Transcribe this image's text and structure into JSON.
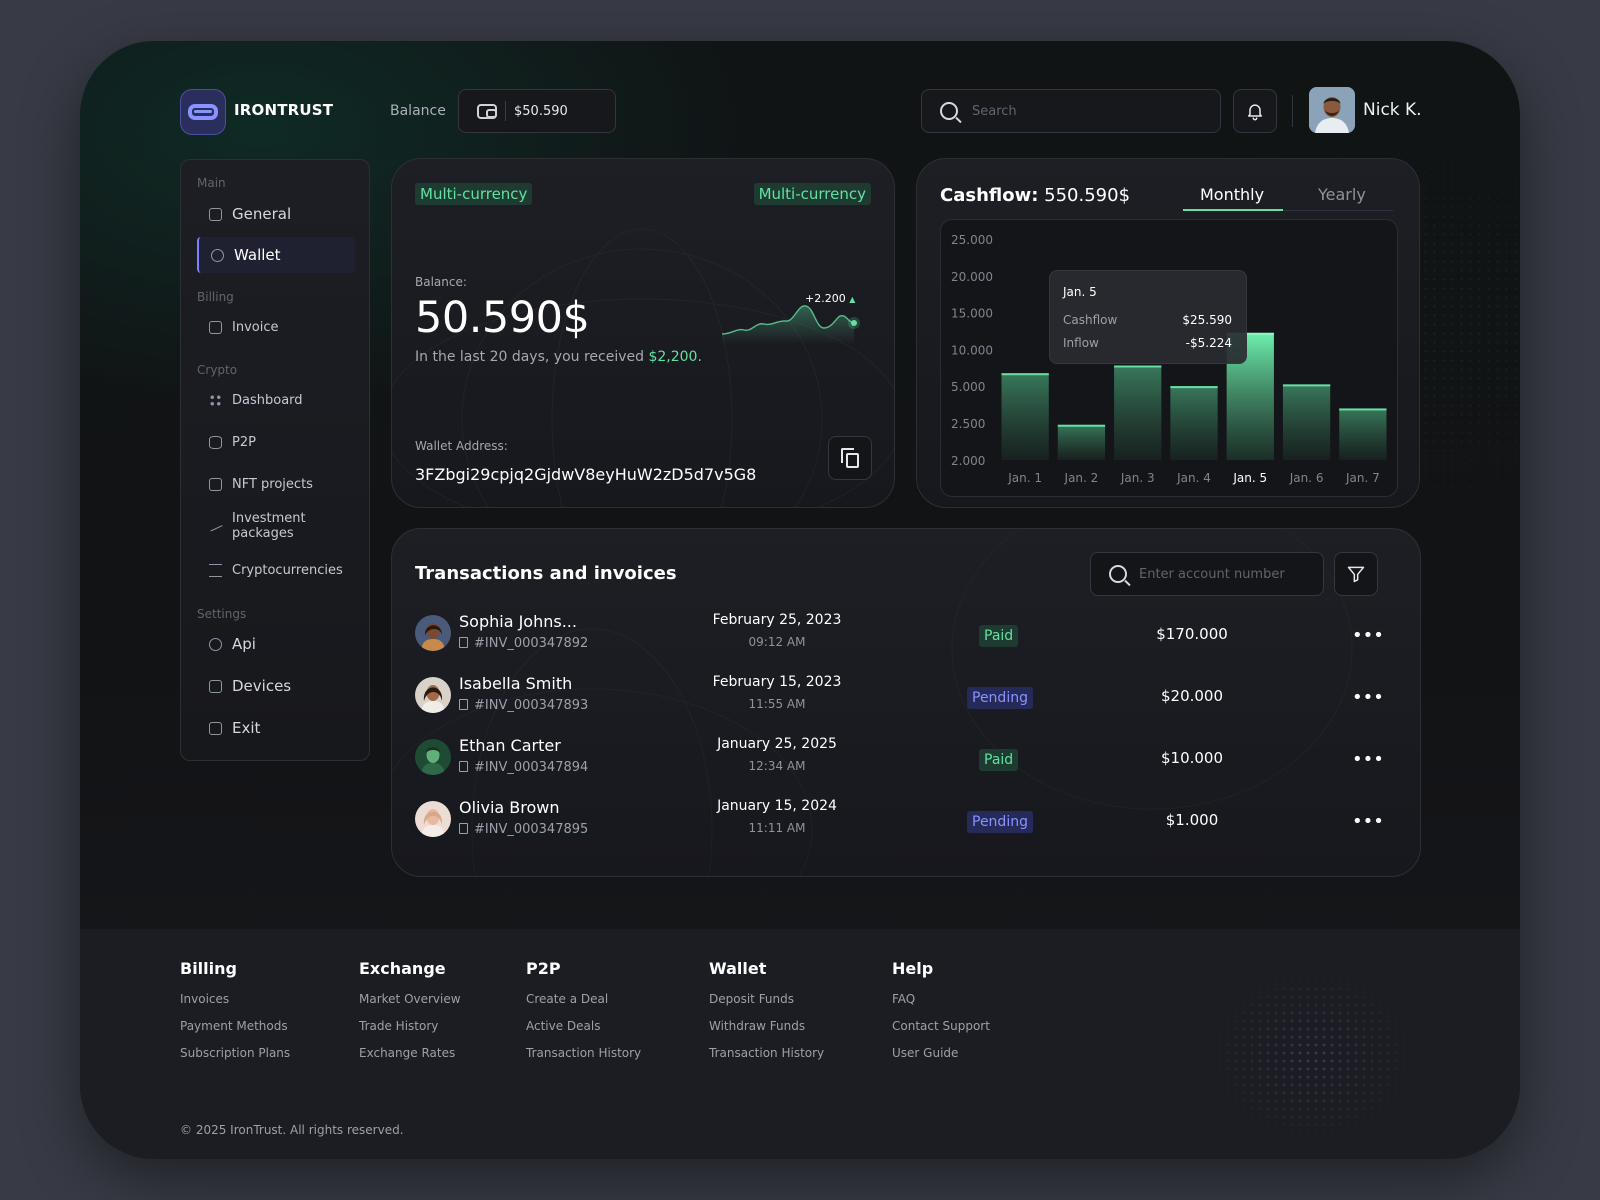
{
  "brand": {
    "name": "IRONTRUST"
  },
  "header": {
    "balance_label": "Balance",
    "balance_value": "$50.590",
    "search_placeholder": "Search",
    "user_name": "Nick K."
  },
  "sidebar": {
    "sections": {
      "main": "Main",
      "billing": "Billing",
      "crypto": "Crypto",
      "settings": "Settings"
    },
    "items": {
      "general": "General",
      "wallet": "Wallet",
      "invoice": "Invoice",
      "dashboard": "Dashboard",
      "p2p": "P2P",
      "nft": "NFT projects",
      "investment": "Investment packages",
      "cryptocurrencies": "Cryptocurrencies",
      "api": "Api",
      "devices": "Devices",
      "exit": "Exit"
    },
    "active": "Wallet"
  },
  "balance_card": {
    "tag_left": "Multi-currency",
    "tag_right": "Multi-currency",
    "label": "Balance:",
    "value": "50.590$",
    "note_prefix": "In the last 20 days, you received ",
    "note_amount": "$2,200.",
    "delta": "+2.200",
    "delta_arrow": "▲",
    "wallet_label": "Wallet Address:",
    "wallet_address": "3FZbgi29cpjq2GjdwV8eyHuW2zD5d7v5G8"
  },
  "cashflow": {
    "title_bold": "Cashflow:",
    "title_value": "550.590$",
    "tabs": [
      "Monthly",
      "Yearly"
    ],
    "active_tab": "Monthly",
    "tooltip": {
      "date": "Jan. 5",
      "rows": [
        {
          "label": "Cashflow",
          "value": "$25.590"
        },
        {
          "label": "Inflow",
          "value": "-$5.224"
        }
      ]
    }
  },
  "chart_data": {
    "type": "bar",
    "categories": [
      "Jan. 1",
      "Jan. 2",
      "Jan. 3",
      "Jan. 4",
      "Jan. 5",
      "Jan. 6",
      "Jan. 7"
    ],
    "values": [
      10100,
      4100,
      11000,
      8600,
      14800,
      8800,
      6000
    ],
    "highlighted": "Jan. 5",
    "y_ticks": [
      "25.000",
      "20.000",
      "15.000",
      "10.000",
      "5.000",
      "2.500",
      "2.000"
    ],
    "ylim": [
      0,
      27000
    ],
    "grid": false,
    "bar_color": "#63e0a2"
  },
  "transactions": {
    "title": "Transactions and invoices",
    "search_placeholder": "Enter account number",
    "rows": [
      {
        "name": "Sophia Johns...",
        "invoice": "#INV_000347892",
        "date": "February 25, 2023",
        "time": "09:12 AM",
        "status": "Paid",
        "amount": "$170.000"
      },
      {
        "name": "Isabella Smith",
        "invoice": "#INV_000347893",
        "date": "February 15, 2023",
        "time": "11:55 AM",
        "status": "Pending",
        "amount": "$20.000"
      },
      {
        "name": "Ethan Carter",
        "invoice": "#INV_000347894",
        "date": "January 25, 2025",
        "time": "12:34 AM",
        "status": "Paid",
        "amount": "$10.000"
      },
      {
        "name": "Olivia Brown",
        "invoice": "#INV_000347895",
        "date": "January 15, 2024",
        "time": "11:11 AM",
        "status": "Pending",
        "amount": "$1.000"
      }
    ],
    "more_label": "•••"
  },
  "footer": {
    "columns": [
      {
        "title": "Billing",
        "links": [
          "Invoices",
          "Payment Methods",
          "Subscription Plans"
        ]
      },
      {
        "title": "Exchange",
        "links": [
          "Market Overview",
          "Trade History",
          "Exchange Rates"
        ]
      },
      {
        "title": "P2P",
        "links": [
          "Create a Deal",
          "Active Deals",
          "Transaction History"
        ]
      },
      {
        "title": "Wallet",
        "links": [
          "Deposit Funds",
          "Withdraw Funds",
          "Transaction History"
        ]
      },
      {
        "title": "Help",
        "links": [
          "FAQ",
          "Contact Support",
          "User Guide"
        ]
      }
    ],
    "copyright": "© 2025 IronTrust. All rights reserved."
  },
  "colors": {
    "accent_green": "#63e0a2",
    "accent_purple": "#8a92ff",
    "background": "#121315"
  },
  "icons": {
    "logo": "wallet-logo-icon",
    "balance": "wallet-icon",
    "search": "search-icon",
    "notifications": "bell-icon",
    "copy": "copy-icon",
    "filter": "filter-icon",
    "more": "more-horizontal-icon",
    "invoice": "document-icon"
  }
}
